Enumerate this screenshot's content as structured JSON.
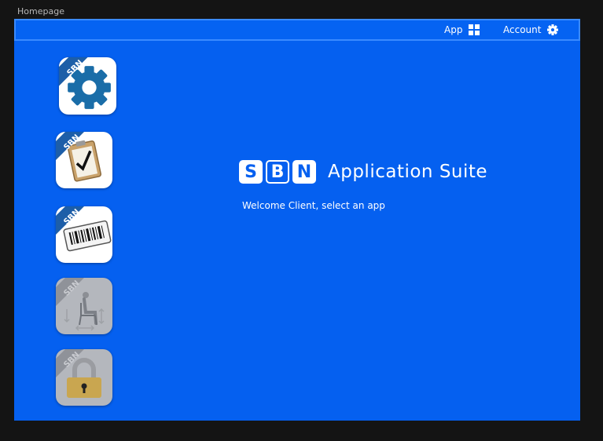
{
  "window": {
    "title": "Homepage"
  },
  "topbar": {
    "app_label": "App",
    "account_label": "Account"
  },
  "brand": {
    "letters": [
      "S",
      "B",
      "N"
    ],
    "title": "Application Suite"
  },
  "welcome_text": "Welcome Client, select an app",
  "apps": [
    {
      "icon": "settings-gear-icon",
      "badge": "SBN",
      "enabled": true
    },
    {
      "icon": "clipboard-checklist-icon",
      "badge": "SBN",
      "enabled": true
    },
    {
      "icon": "barcode-label-icon",
      "badge": "SBN",
      "enabled": true
    },
    {
      "icon": "seated-person-measure-icon",
      "badge": "SBN",
      "enabled": false
    },
    {
      "icon": "padlock-icon",
      "badge": "SBN",
      "enabled": false
    }
  ],
  "colors": {
    "background": "#141414",
    "frame": "#0560f0",
    "topbar_border": "#3a8bff",
    "ribbon": "#1d5ea8",
    "text": "#ffffff"
  }
}
